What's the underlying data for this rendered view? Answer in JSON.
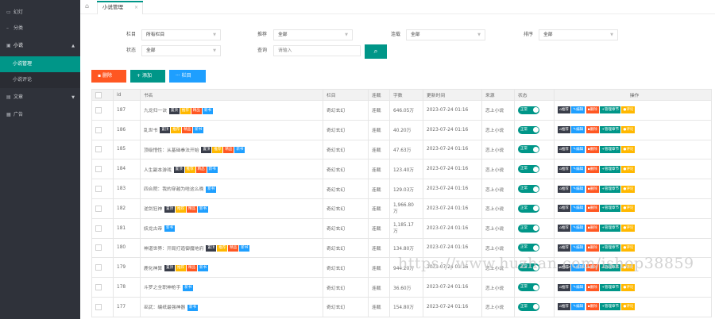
{
  "sidebar": {
    "items": [
      {
        "label": "幻灯",
        "icon": "image-icon"
      },
      {
        "label": "分类",
        "icon": "list-icon"
      },
      {
        "label": "小说",
        "icon": "book-icon"
      },
      {
        "label": "文章",
        "icon": "doc-icon"
      },
      {
        "label": "广告",
        "icon": "ad-icon"
      }
    ],
    "subitems": [
      {
        "label": "小说管理"
      },
      {
        "label": "小说评论"
      }
    ]
  },
  "header": {
    "tab_label": "小说管理",
    "tab_close": "×"
  },
  "filters": {
    "category_label": "栏目",
    "category_value": "所有栏目",
    "recommend_label": "推荐",
    "recommend_value": "全部",
    "serial_label": "连载",
    "serial_value": "全部",
    "sort_label": "排序",
    "sort_value": "全部",
    "status_label": "状态",
    "status_value": "全部",
    "query_label": "查询",
    "query_placeholder": "请输入"
  },
  "toolbar": {
    "delete_label": "删除",
    "add_label": "添加",
    "column_label": "栏目"
  },
  "table": {
    "columns": [
      "id",
      "书名",
      "栏目",
      "连载",
      "字数",
      "更新时间",
      "来源",
      "状态",
      "操作"
    ],
    "tags": {
      "top": "置顶",
      "recommend": "推荐",
      "featured": "精品",
      "new": "新书"
    },
    "status_on": "正常",
    "actions": {
      "recommend": "推荐",
      "edit": "编辑",
      "delete": "删除",
      "chapters": "管理章节",
      "comments": "评论"
    },
    "rows": [
      {
        "id": "187",
        "name": "九龙归一诀",
        "tags": [
          "top",
          "recommend",
          "featured",
          "new"
        ],
        "category": "奇幻玄幻",
        "serial": "连载",
        "words": "646.05万",
        "time": "2023-07-24 01:16",
        "source": "恋上小说"
      },
      {
        "id": "186",
        "name": "乱世书",
        "tags": [
          "top",
          "recommend",
          "featured",
          "new"
        ],
        "category": "奇幻玄幻",
        "serial": "连载",
        "words": "40.20万",
        "time": "2023-07-24 01:16",
        "source": "恋上小说"
      },
      {
        "id": "185",
        "name": "顶级悟性：从基础拳法开始",
        "tags": [
          "top",
          "recommend",
          "featured",
          "new"
        ],
        "category": "奇幻玄幻",
        "serial": "连载",
        "words": "47.63万",
        "time": "2023-07-24 01:16",
        "source": "恋上小说"
      },
      {
        "id": "184",
        "name": "人生副本游戏",
        "tags": [
          "top",
          "recommend",
          "featured",
          "new"
        ],
        "category": "奇幻玄幻",
        "serial": "连载",
        "words": "123.40万",
        "time": "2023-07-24 01:16",
        "source": "恋上小说"
      },
      {
        "id": "183",
        "name": "四合院：我的穿越为啥这么晚",
        "tags": [
          "new"
        ],
        "category": "奇幻玄幻",
        "serial": "连载",
        "words": "129.03万",
        "time": "2023-07-24 01:16",
        "source": "恋上小说"
      },
      {
        "id": "182",
        "name": "逆剑狂神",
        "tags": [
          "top",
          "recommend",
          "featured",
          "new"
        ],
        "category": "奇幻玄幻",
        "serial": "连载",
        "words": "1,966.80万",
        "time": "2023-07-24 01:16",
        "source": "恋上小说"
      },
      {
        "id": "181",
        "name": "妖龙古帝",
        "tags": [
          "new"
        ],
        "category": "奇幻玄幻",
        "serial": "连载",
        "words": "1,185.17万",
        "time": "2023-07-24 01:16",
        "source": "恋上小说"
      },
      {
        "id": "180",
        "name": "神道世界：开局打造御魔地府",
        "tags": [
          "top",
          "recommend",
          "featured",
          "new"
        ],
        "category": "奇幻玄幻",
        "serial": "连载",
        "words": "134.80万",
        "time": "2023-07-24 01:16",
        "source": "恋上小说"
      },
      {
        "id": "179",
        "name": "鹿化神算",
        "tags": [
          "top",
          "recommend",
          "featured",
          "new"
        ],
        "category": "奇幻玄幻",
        "serial": "连载",
        "words": "944.20万",
        "time": "2023-07-24 01:16",
        "source": "恋上小说"
      },
      {
        "id": "178",
        "name": "斗罗之全职神枪手",
        "tags": [
          "new"
        ],
        "category": "奇幻玄幻",
        "serial": "连载",
        "words": "36.60万",
        "time": "2023-07-24 01:16",
        "source": "恋上小说"
      },
      {
        "id": "177",
        "name": "巫武：编纸最强神器",
        "tags": [
          "new"
        ],
        "category": "奇幻玄幻",
        "serial": "连载",
        "words": "154.80万",
        "time": "2023-07-24 01:16",
        "source": "恋上小说"
      }
    ]
  },
  "watermark": "https://www.huzhan.com/ishop38859",
  "colors": {
    "accent": "#009688",
    "sidebar_bg": "#2f323a",
    "danger": "#ff5722",
    "normal": "#1e9fff",
    "warm": "#ffb800",
    "dark": "#393d49"
  }
}
